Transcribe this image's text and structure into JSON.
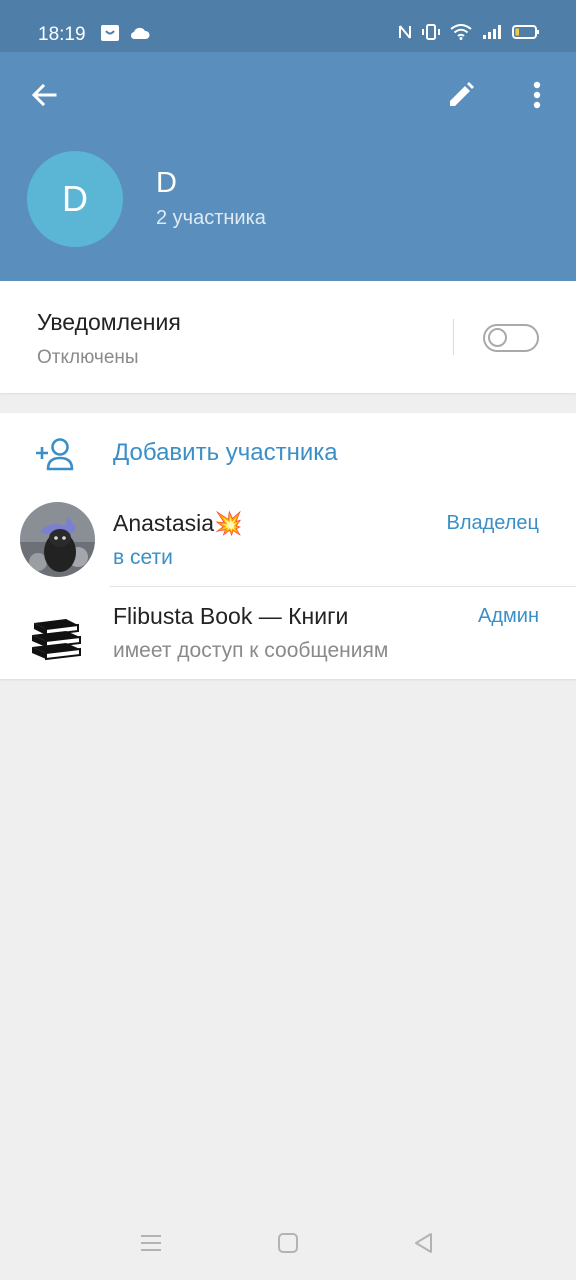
{
  "status_bar": {
    "time": "18:19",
    "icons": [
      "app-notification-icon",
      "cloud-icon",
      "nfc-icon",
      "vibrate-icon",
      "wifi-icon",
      "signal-icon",
      "battery-icon"
    ]
  },
  "header": {
    "avatar_letter": "D",
    "title": "D",
    "subtitle": "2 участника",
    "actions": [
      "back-arrow-icon",
      "edit-pencil-icon",
      "more-vert-icon"
    ]
  },
  "notifications": {
    "title": "Уведомления",
    "status": "Отключены",
    "enabled": false
  },
  "members": {
    "add_label": "Добавить участника",
    "items": [
      {
        "name": "Anastasia",
        "emoji": "💥",
        "status": "в сети",
        "role": "Владелец",
        "online": true
      },
      {
        "name": "Flibusta Book — Книги",
        "status": "имеет доступ к сообщениям",
        "role": "Админ",
        "online": false
      }
    ]
  },
  "colors": {
    "header_bg": "#5a8fbd",
    "status_bar_bg": "#4f7fa8",
    "accent": "#3b8fc7",
    "avatar_bg": "#5bb5d5"
  },
  "nav_bar": [
    "menu-icon",
    "home-square-icon",
    "back-triangle-icon"
  ]
}
